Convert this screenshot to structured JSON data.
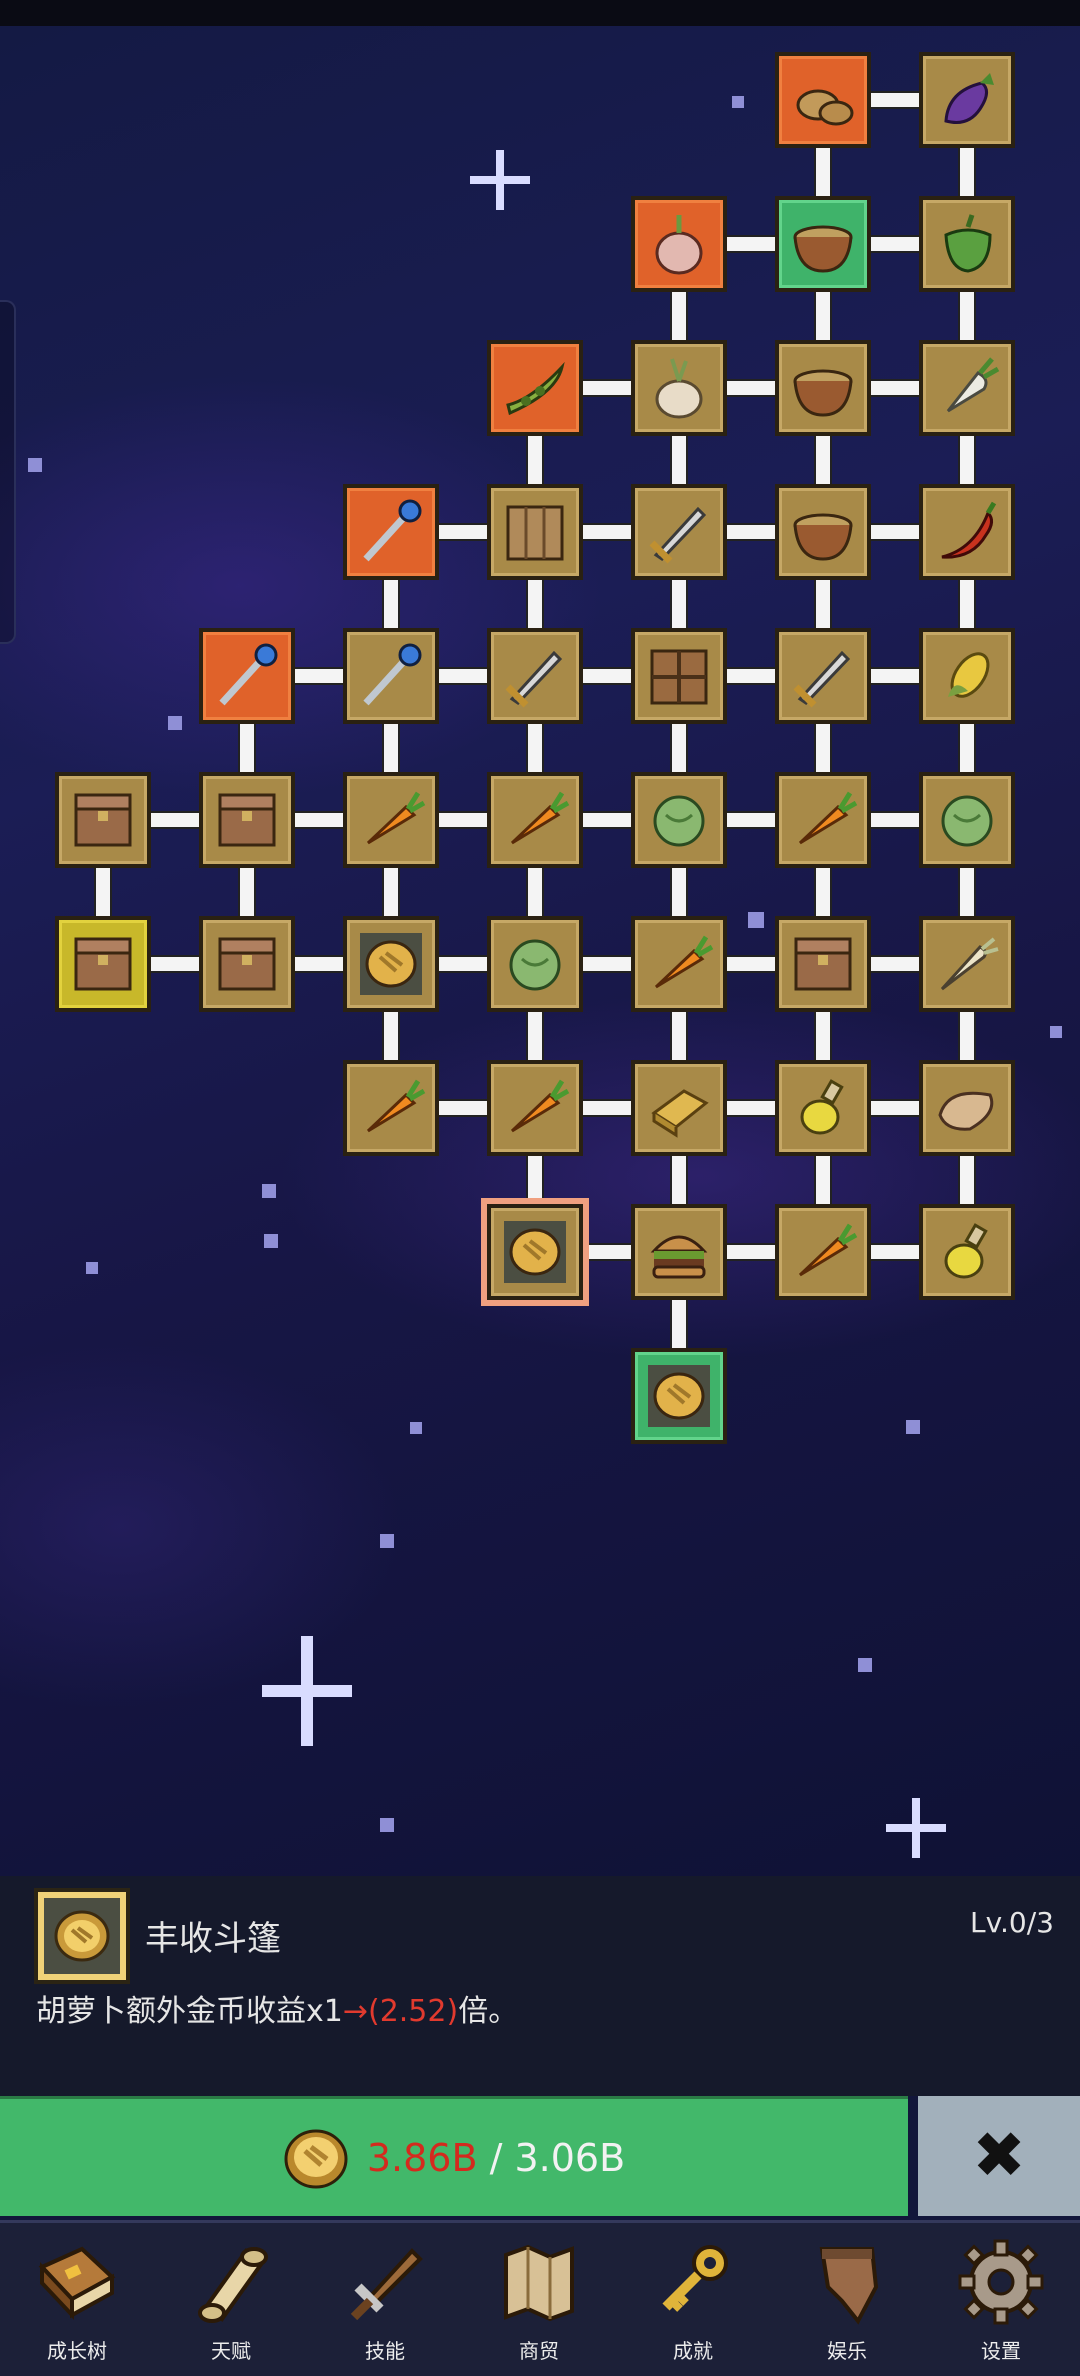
{
  "nav": {
    "items": [
      {
        "label": "成长树",
        "icon": "book-icon"
      },
      {
        "label": "天赋",
        "icon": "scroll-icon"
      },
      {
        "label": "技能",
        "icon": "sword-icon"
      },
      {
        "label": "商贸",
        "icon": "map-icon"
      },
      {
        "label": "成就",
        "icon": "key-icon"
      },
      {
        "label": "娱乐",
        "icon": "banner-icon"
      },
      {
        "label": "设置",
        "icon": "gear-icon"
      }
    ]
  },
  "info": {
    "title": "丰收斗篷",
    "level": "Lv.0/3",
    "desc_prefix": "胡萝卜额外金币收益x1",
    "desc_arrow": "→",
    "desc_value": "(2.52)",
    "desc_suffix": "倍。",
    "icon": "coin-cloak-icon"
  },
  "buy": {
    "current": "3.86B",
    "separator": " / ",
    "cost": "3.06B",
    "icon": "gold-coin-icon"
  },
  "close": {
    "label": "✖"
  },
  "tree": {
    "nodes": [
      {
        "name": "potato",
        "col": 5,
        "row": 0,
        "style": "orange",
        "icon": "potato-icon"
      },
      {
        "name": "eggplant",
        "col": 6,
        "row": 0,
        "style": "gold",
        "icon": "eggplant-icon"
      },
      {
        "name": "onion",
        "col": 4,
        "row": 1,
        "style": "orange",
        "icon": "onion-icon"
      },
      {
        "name": "bowl-1",
        "col": 5,
        "row": 1,
        "style": "green",
        "icon": "bowl-icon"
      },
      {
        "name": "pepper",
        "col": 6,
        "row": 1,
        "style": "gold",
        "icon": "bell-pepper-icon"
      },
      {
        "name": "peapod",
        "col": 3,
        "row": 2,
        "style": "orange",
        "icon": "peapod-icon"
      },
      {
        "name": "garlic",
        "col": 4,
        "row": 2,
        "style": "gold",
        "icon": "garlic-icon"
      },
      {
        "name": "bowl-2",
        "col": 5,
        "row": 2,
        "style": "gold",
        "icon": "bowl-icon"
      },
      {
        "name": "radish",
        "col": 6,
        "row": 2,
        "style": "gold",
        "icon": "radish-icon"
      },
      {
        "name": "blue-staff",
        "col": 2,
        "row": 3,
        "style": "orange",
        "icon": "staff-icon"
      },
      {
        "name": "board",
        "col": 3,
        "row": 3,
        "style": "gold",
        "icon": "plank-icon"
      },
      {
        "name": "gold-sword",
        "col": 4,
        "row": 3,
        "style": "gold",
        "icon": "sword-icon"
      },
      {
        "name": "bowl-3",
        "col": 5,
        "row": 3,
        "style": "gold",
        "icon": "bowl-icon"
      },
      {
        "name": "chili",
        "col": 6,
        "row": 3,
        "style": "gold",
        "icon": "chili-icon"
      },
      {
        "name": "ruby-staff",
        "col": 1,
        "row": 4,
        "style": "orange",
        "icon": "staff-icon"
      },
      {
        "name": "green-staff",
        "col": 2,
        "row": 4,
        "style": "gold",
        "icon": "staff-icon"
      },
      {
        "name": "iron-sword",
        "col": 3,
        "row": 4,
        "style": "gold",
        "icon": "sword-icon"
      },
      {
        "name": "crate",
        "col": 4,
        "row": 4,
        "style": "gold",
        "icon": "crate-icon"
      },
      {
        "name": "short-sword",
        "col": 5,
        "row": 4,
        "style": "gold",
        "icon": "sword-icon"
      },
      {
        "name": "corn",
        "col": 6,
        "row": 4,
        "style": "gold",
        "icon": "corn-icon"
      },
      {
        "name": "chest-red",
        "col": 0,
        "row": 5,
        "style": "gold",
        "icon": "chest-icon"
      },
      {
        "name": "chest-wood",
        "col": 1,
        "row": 5,
        "style": "gold",
        "icon": "chest-icon"
      },
      {
        "name": "carrot-up-1",
        "col": 2,
        "row": 5,
        "style": "gold",
        "icon": "carrot-icon"
      },
      {
        "name": "carrot-up-2",
        "col": 3,
        "row": 5,
        "style": "gold",
        "icon": "carrot-icon"
      },
      {
        "name": "cabbage-1",
        "col": 4,
        "row": 5,
        "style": "gold",
        "icon": "cabbage-icon"
      },
      {
        "name": "carrot-up-3",
        "col": 5,
        "row": 5,
        "style": "gold",
        "icon": "carrot-icon"
      },
      {
        "name": "cabbage-2",
        "col": 6,
        "row": 5,
        "style": "gold",
        "icon": "cabbage-icon"
      },
      {
        "name": "chest-gold",
        "col": 0,
        "row": 6,
        "style": "yellow",
        "icon": "chest-icon"
      },
      {
        "name": "chest-wood-2",
        "col": 1,
        "row": 6,
        "style": "gold",
        "icon": "chest-icon"
      },
      {
        "name": "coin-green",
        "col": 2,
        "row": 6,
        "style": "gold",
        "icon": "coin-icon"
      },
      {
        "name": "cabbage-3",
        "col": 3,
        "row": 6,
        "style": "gold",
        "icon": "cabbage-icon"
      },
      {
        "name": "carrot-up-4",
        "col": 4,
        "row": 6,
        "style": "gold",
        "icon": "carrot-icon"
      },
      {
        "name": "open-chest",
        "col": 5,
        "row": 6,
        "style": "gold",
        "icon": "chest-icon"
      },
      {
        "name": "parsnip",
        "col": 6,
        "row": 6,
        "style": "gold",
        "icon": "parsnip-icon"
      },
      {
        "name": "carrot-up-5",
        "col": 2,
        "row": 7,
        "style": "gold",
        "icon": "carrot-icon"
      },
      {
        "name": "carrot-up-6",
        "col": 3,
        "row": 7,
        "style": "gold",
        "icon": "carrot-icon"
      },
      {
        "name": "gold-bar",
        "col": 4,
        "row": 7,
        "style": "gold",
        "icon": "gold-bar-icon"
      },
      {
        "name": "potion",
        "col": 5,
        "row": 7,
        "style": "gold",
        "icon": "potion-icon"
      },
      {
        "name": "bread",
        "col": 6,
        "row": 7,
        "style": "gold",
        "icon": "bread-icon"
      },
      {
        "name": "coin-selected",
        "col": 3,
        "row": 8,
        "style": "gold",
        "icon": "coin-icon",
        "selected": true
      },
      {
        "name": "burger",
        "col": 4,
        "row": 8,
        "style": "gold",
        "icon": "burger-icon"
      },
      {
        "name": "carrot-crate",
        "col": 5,
        "row": 8,
        "style": "gold",
        "icon": "carrot-icon"
      },
      {
        "name": "oil-bottle",
        "col": 6,
        "row": 8,
        "style": "gold",
        "icon": "potion-icon"
      },
      {
        "name": "coin-purple",
        "col": 4,
        "row": 9,
        "style": "green",
        "icon": "coin-icon"
      }
    ]
  }
}
